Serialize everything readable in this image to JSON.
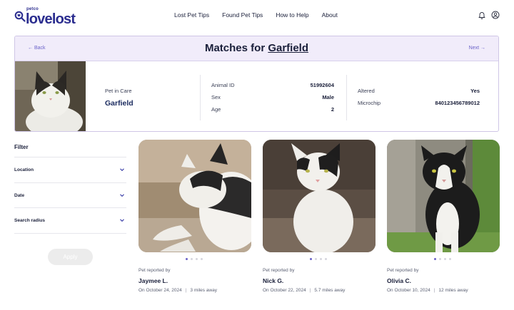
{
  "brand": {
    "petco": "petco",
    "name": "lovelost",
    "color": "#2b2d8f"
  },
  "nav": {
    "links": [
      "Lost Pet Tips",
      "Found Pet Tips",
      "How to Help",
      "About"
    ]
  },
  "header_icons": [
    "bell-icon",
    "user-account-icon"
  ],
  "match": {
    "back_label": "← Back",
    "next_label": "Next →",
    "title_prefix": "Matches for",
    "pet_name": "Garfield",
    "pet_in_care_label": "Pet in Care",
    "details_left": [
      {
        "key": "Animal ID",
        "value": "51992604"
      },
      {
        "key": "Sex",
        "value": "Male"
      },
      {
        "key": "Age",
        "value": "2"
      }
    ],
    "details_right": [
      {
        "key": "Altered",
        "value": "Yes"
      },
      {
        "key": "Microchip",
        "value": "840123456789012"
      }
    ]
  },
  "filters": {
    "title": "Filter",
    "items": [
      "Location",
      "Date",
      "Search radius"
    ],
    "apply_label": "Apply"
  },
  "results": [
    {
      "reported_label": "Pet reported by",
      "name": "Jaymee L.",
      "date": "On October 24, 2024",
      "distance": "3 miles away"
    },
    {
      "reported_label": "Pet reported by",
      "name": "Nick G.",
      "date": "On October 22, 2024",
      "distance": "5.7 miles away"
    },
    {
      "reported_label": "Pet reported by",
      "name": "Olivia C.",
      "date": "On October 10, 2024",
      "distance": "12 miles away"
    }
  ],
  "colors": {
    "accent": "#6b63c9",
    "band": "#f1ecfa",
    "title": "#1a1f3a"
  }
}
